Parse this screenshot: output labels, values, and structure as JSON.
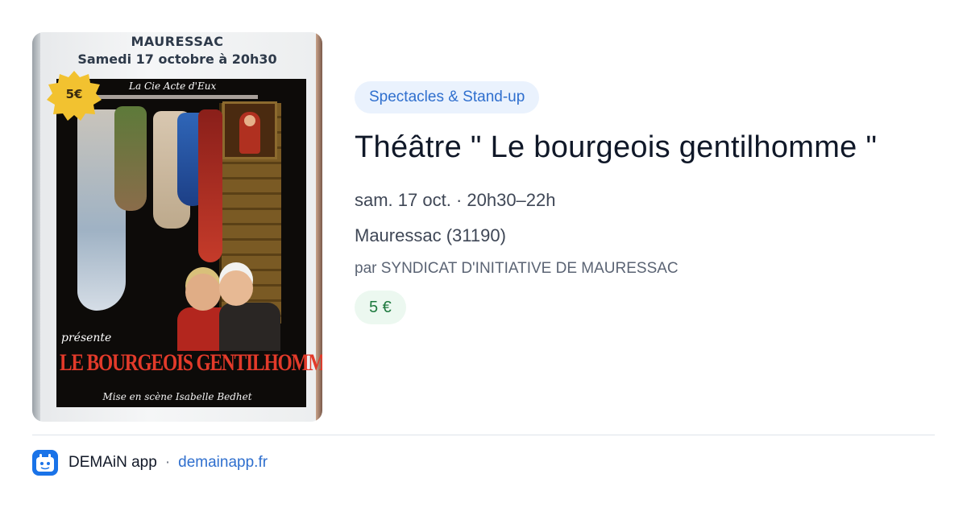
{
  "poster": {
    "town": "MAURESSAC",
    "date": "Samedi 17 octobre à 20h30",
    "price": "5€",
    "company": "La Cie Acte d'Eux",
    "presents": "présente",
    "play_title": "LE BOURGEOIS GENTILHOMME",
    "credit": "Mise en scène Isabelle Bedhet"
  },
  "event": {
    "category": "Spectacles & Stand-up",
    "title": "Théâtre \" Le bourgeois gentilhomme \"",
    "datetime": "sam. 17 oct. · 20h30–22h",
    "location": "Mauressac (31190)",
    "organizer": "par SYNDICAT D'INITIATIVE DE MAURESSAC",
    "price": "5 €"
  },
  "footer": {
    "app_name": "DEMAiN app",
    "separator": "·",
    "link": "demainapp.fr",
    "icon": "demain-app-icon"
  },
  "colors": {
    "accent": "#2f6fce",
    "category_bg": "#eaf2fd",
    "price_text": "#1f7a3f",
    "price_bg": "#ecf8f0",
    "app_icon": "#1a73e8"
  }
}
